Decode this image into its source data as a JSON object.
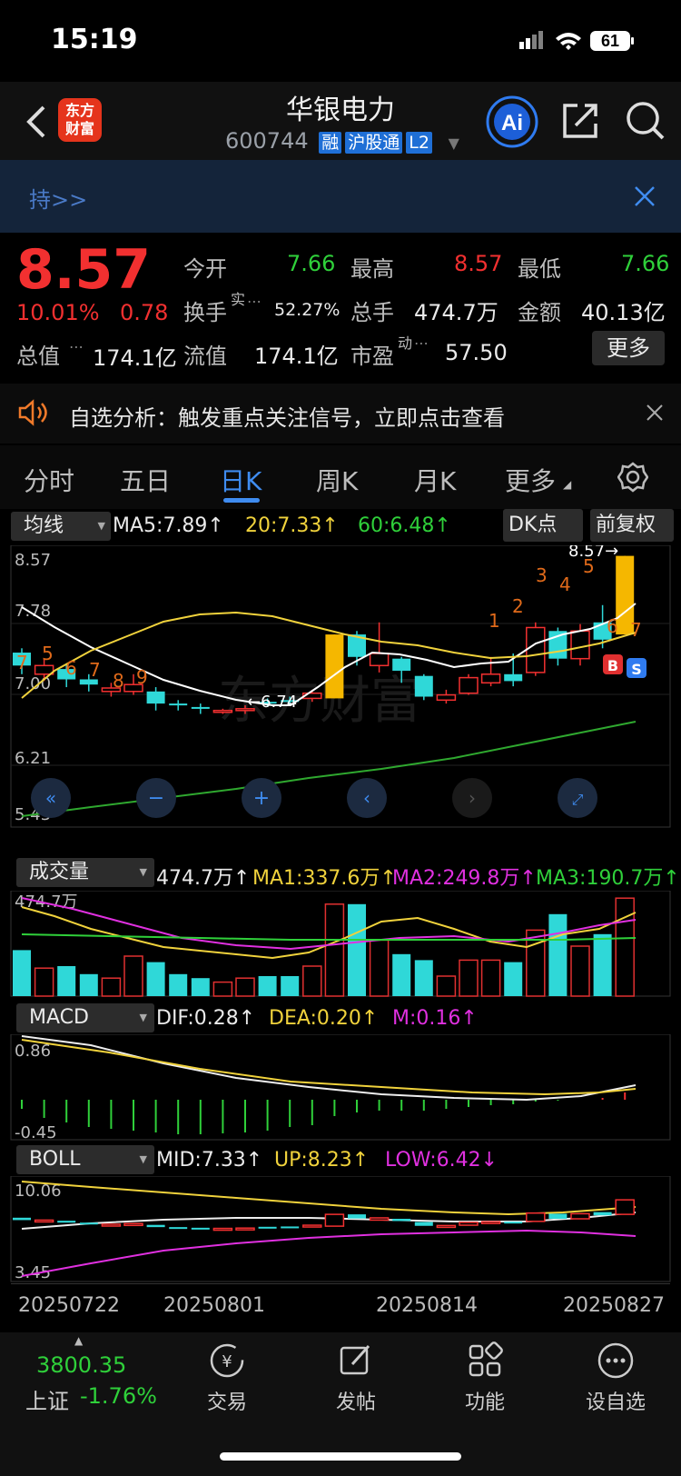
{
  "status": {
    "time": "15:19",
    "battery": "61"
  },
  "header": {
    "stock_name": "华银电力",
    "stock_code": "600744",
    "tags": [
      "融",
      "沪股通",
      "L2"
    ],
    "logo_text": [
      "东方",
      "财富"
    ],
    "ai_label": "Ai"
  },
  "banner": {
    "text": "持>>"
  },
  "quote": {
    "price": "8.57",
    "change_pct": "10.01%",
    "change": "0.78",
    "open_label": "今开",
    "open": "7.66",
    "high_label": "最高",
    "high": "8.57",
    "low_label": "最低",
    "low": "7.66",
    "turnover_label": "换手",
    "turnover_sup": "实",
    "turnover": "52.27%",
    "volume_label": "总手",
    "volume": "474.7万",
    "amount_label": "金额",
    "amount": "40.13亿",
    "mktcap_label": "总值",
    "mktcap": "174.1亿",
    "float_label": "流值",
    "float": "174.1亿",
    "pe_label": "市盈",
    "pe_sup": "动",
    "pe": "57.50",
    "more": "更多"
  },
  "notice": {
    "text": "自选分析：触发重点关注信号，立即点击查看"
  },
  "tabs": [
    "分时",
    "五日",
    "日K",
    "周K",
    "月K",
    "更多"
  ],
  "active_tab": "日K",
  "ma": {
    "selector": "均线",
    "ma5": "MA5:7.89↑",
    "ma20": "20:7.33↑",
    "ma60": "60:6.48↑",
    "dk": "DK点",
    "adjust": "前复权"
  },
  "kline": {
    "y_labels": [
      "8.57",
      "7.78",
      "7.00",
      "6.21",
      "5.43"
    ],
    "max_label": "8.57→",
    "min_label": "←6.74",
    "markers": [
      "B",
      "S"
    ]
  },
  "volume": {
    "selector": "成交量",
    "vol": "474.7万↑",
    "ma1": "MA1:337.6万↑",
    "ma2": "MA2:249.8万↑",
    "ma3": "MA3:190.7万↑",
    "top_label": "474.7万"
  },
  "macd": {
    "selector": "MACD",
    "dif": "DIF:0.28↑",
    "dea": "DEA:0.20↑",
    "m": "M:0.16↑",
    "top_label": "0.86",
    "bottom_label": "-0.45"
  },
  "boll": {
    "selector": "BOLL",
    "mid": "MID:7.33↑",
    "up": "UP:8.23↑",
    "low": "LOW:6.42↓",
    "top_label": "10.06",
    "bottom_label": "3.45"
  },
  "dates": [
    "20250722",
    "20250801",
    "20250814",
    "20250827"
  ],
  "footer": {
    "index_value": "3800.35",
    "index_name": "上证",
    "index_change": "-1.76%",
    "items": [
      "交易",
      "发帖",
      "功能",
      "设自选"
    ]
  },
  "chart_data": {
    "type": "candlestick",
    "candles": [
      {
        "o": 7.45,
        "c": 7.3,
        "h": 7.5,
        "l": 7.2,
        "up": false
      },
      {
        "o": 7.3,
        "c": 7.2,
        "h": 7.38,
        "l": 7.12,
        "up": true
      },
      {
        "o": 7.26,
        "c": 7.14,
        "h": 7.32,
        "l": 7.05,
        "up": false
      },
      {
        "o": 7.14,
        "c": 7.08,
        "h": 7.2,
        "l": 7.0,
        "up": false
      },
      {
        "o": 7.0,
        "c": 7.04,
        "h": 7.1,
        "l": 6.94,
        "up": true
      },
      {
        "o": 7.0,
        "c": 7.08,
        "h": 7.2,
        "l": 6.96,
        "up": true
      },
      {
        "o": 7.0,
        "c": 6.86,
        "h": 7.05,
        "l": 6.78,
        "up": false
      },
      {
        "o": 6.86,
        "c": 6.84,
        "h": 6.9,
        "l": 6.78,
        "up": false
      },
      {
        "o": 6.82,
        "c": 6.8,
        "h": 6.86,
        "l": 6.74,
        "up": false
      },
      {
        "o": 6.78,
        "c": 6.76,
        "h": 6.8,
        "l": 6.74,
        "up": true
      },
      {
        "o": 6.8,
        "c": 6.78,
        "h": 6.84,
        "l": 6.74,
        "up": true
      },
      {
        "o": 6.88,
        "c": 6.86,
        "h": 6.92,
        "l": 6.82,
        "up": false
      },
      {
        "o": 6.9,
        "c": 6.88,
        "h": 6.94,
        "l": 6.84,
        "up": false
      },
      {
        "o": 6.92,
        "c": 6.98,
        "h": 7.02,
        "l": 6.88,
        "up": true
      },
      {
        "o": 6.92,
        "c": 7.66,
        "h": 7.66,
        "l": 6.92,
        "up": true,
        "limit": true
      },
      {
        "o": 7.66,
        "c": 7.4,
        "h": 7.7,
        "l": 7.3,
        "up": false
      },
      {
        "o": 7.3,
        "c": 7.44,
        "h": 7.8,
        "l": 7.22,
        "up": true
      },
      {
        "o": 7.38,
        "c": 7.24,
        "h": 7.4,
        "l": 7.1,
        "up": false
      },
      {
        "o": 7.18,
        "c": 6.94,
        "h": 7.2,
        "l": 6.9,
        "up": false
      },
      {
        "o": 6.9,
        "c": 6.96,
        "h": 7.02,
        "l": 6.86,
        "up": true
      },
      {
        "o": 6.98,
        "c": 7.16,
        "h": 7.2,
        "l": 6.96,
        "up": true
      },
      {
        "o": 7.1,
        "c": 7.2,
        "h": 7.4,
        "l": 7.06,
        "up": true
      },
      {
        "o": 7.2,
        "c": 7.12,
        "h": 7.44,
        "l": 7.06,
        "up": false
      },
      {
        "o": 7.22,
        "c": 7.74,
        "h": 7.8,
        "l": 7.18,
        "up": true
      },
      {
        "o": 7.7,
        "c": 7.38,
        "h": 7.74,
        "l": 7.3,
        "up": false
      },
      {
        "o": 7.38,
        "c": 7.7,
        "h": 7.78,
        "l": 7.3,
        "up": true
      },
      {
        "o": 7.8,
        "c": 7.6,
        "h": 8.0,
        "l": 7.5,
        "up": false
      },
      {
        "o": 7.66,
        "c": 8.57,
        "h": 8.57,
        "l": 7.66,
        "up": true,
        "limit": true
      }
    ]
  }
}
